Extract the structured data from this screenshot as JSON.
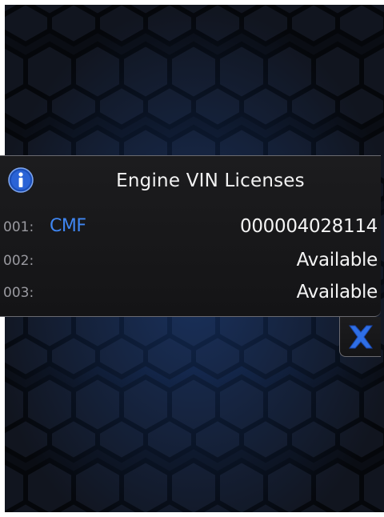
{
  "dialog": {
    "title": "Engine VIN Licenses",
    "rows": [
      {
        "num": "001:",
        "name": "CMF",
        "value": "000004028114"
      },
      {
        "num": "002:",
        "name": "",
        "value": "Available"
      },
      {
        "num": "003:",
        "name": "",
        "value": "Available"
      }
    ]
  },
  "icons": {
    "info": "info-icon",
    "close": "close-icon"
  },
  "colors": {
    "accent_blue": "#3f86f2",
    "info_icon_fill": "#1c4fb8",
    "close_icon": "#2f6fe6",
    "background": "#0a0d14"
  }
}
